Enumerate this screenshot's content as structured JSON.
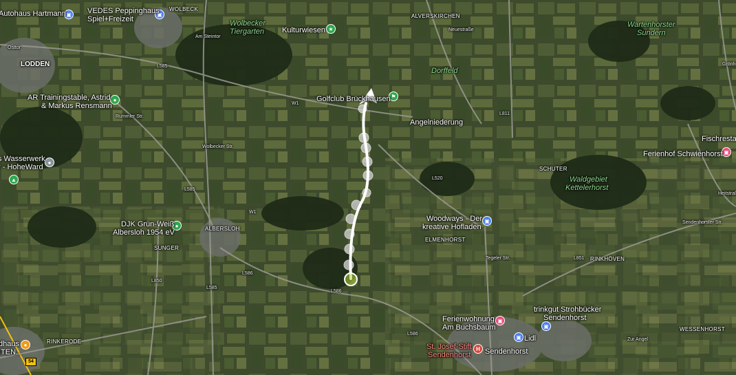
{
  "labels": {
    "autohaus_hartmann": "Autohaus Hartmann",
    "vedes_1": "VEDES Peppinghaus",
    "vedes_2": "Spiel+Freizeit",
    "wolbeck": "WOLBECK",
    "wolbecker_tiergarten_1": "Wolbecker",
    "wolbecker_tiergarten_2": "Tiergarten",
    "kulturwiesen": "Kulturwiesen",
    "alverskirchen": "ALVERSKIRCHEN",
    "wartenhorster_1": "Wartenhorster",
    "wartenhorster_2": "Sundern",
    "ostlor": "Osttor",
    "lodden": "LODDEN",
    "dorffeld": "Dorffeld",
    "golfclub": "Golfclub Brückhausen",
    "ar_training_1": "AR Trainingstable, Astrid",
    "ar_training_2": "& Markus Rensmann",
    "angelniederung": "Angelniederung",
    "fischrestau": "Fischrestau",
    "ferienhof": "Ferienhof Schwienhorst",
    "wasserwerk_1": "s Wasserwerk",
    "wasserwerk_2": "r - HoheWard",
    "schuter": "SCHUTER",
    "waldgebiet_1": "Waldgebiet",
    "waldgebiet_2": "Kettelerhorst",
    "djk_1": "DJK Grün-Weiß",
    "djk_2": "Albersloh 1954 eV",
    "albersloh": "ALBERSLOH",
    "woodways_1": "Woodways - Der",
    "woodways_2": "kreative Hofladen",
    "elmenhorst": "ELMENHORST",
    "sunger": "SUNGER",
    "rinkhoven": "RINKHÖVEN",
    "ferienwohnung_1": "Ferienwohnung",
    "ferienwohnung_2": "Am Buchsbaum",
    "trinkgut_1": "trinkgut Strohbücker",
    "trinkgut_2": "Sendenhorst",
    "wessenhorst": "WESSENHORST",
    "lidl": "Lidl",
    "st_josef_1": "St. Josef-Stift",
    "st_josef_2": "Sendenhorst",
    "sendenhorst": "Sendenhorst",
    "dhaus_1": "dhaus",
    "dhaus_2": "ITEN...",
    "rinkerode": "RINKERODE"
  },
  "roads": {
    "l585": "L585",
    "w1": "W1",
    "l811": "L811",
    "l520": "L520",
    "l851": "L851",
    "l586_a": "L586",
    "l586_b": "L586",
    "l586_c": "L586",
    "l585_b": "L585",
    "l850": "L850",
    "l585_c": "L585",
    "am_steinbr": "Am Steintor",
    "wolbecker_str": "Wolbecker Str.",
    "rummler_str": "Rummler Str.",
    "neuestr": "Neuestraße",
    "tegeler_str": "Tegeler Str.",
    "sendenhorster_str": "Sendenhorster Str.",
    "heitstrasse": "Heitstraße",
    "gronhorst": "Grönhorst",
    "zur_angel": "Zur Angel",
    "w1_b": "W1",
    "l586_d": "L586",
    "a54": "54"
  },
  "icons": {
    "shop": "shopping-bag-icon",
    "museum": "museum-icon",
    "sport": "sport-icon",
    "park": "park-icon",
    "golf": "golf-icon",
    "bed": "bed-icon",
    "hospital": "hospital-icon",
    "food": "restaurant-icon",
    "fuel": "pin-icon"
  },
  "colors": {
    "route": "#ffffff",
    "route_start": "#b5d33d",
    "shop_pin": "#4a7ff0",
    "green_pin": "#2fa84f",
    "bed_pin": "#e8497a",
    "hospital_pin": "#d9453a",
    "food_pin": "#f09a1a",
    "gray_pin": "#8a939c"
  }
}
